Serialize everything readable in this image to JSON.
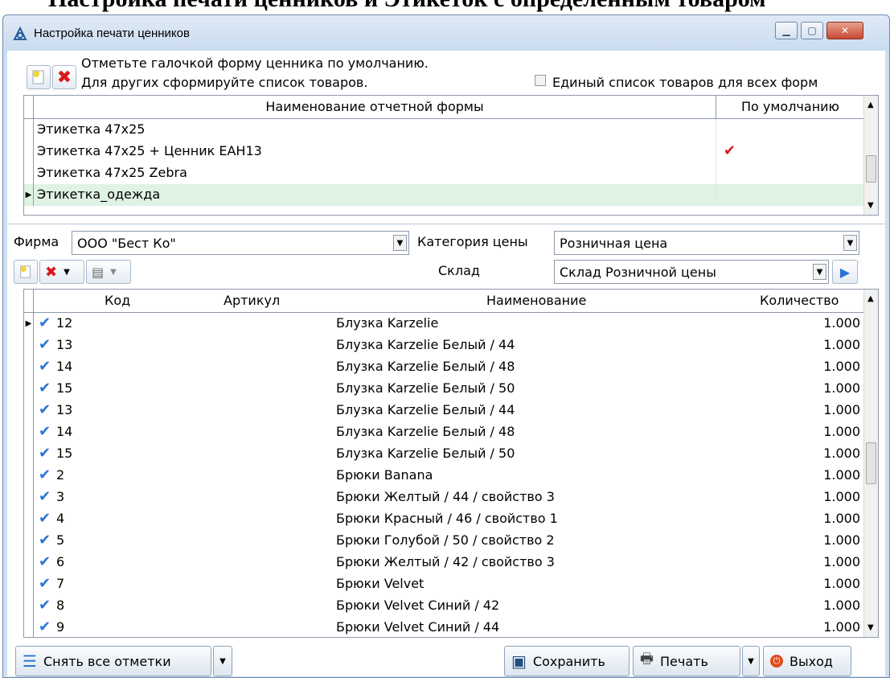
{
  "document_heading": "Настройка печати ценников и Этикеток с определенным товаром",
  "window": {
    "title": "Настройка печати ценников",
    "controls": [
      "minimize-icon",
      "maximize-icon",
      "close-icon"
    ]
  },
  "top": {
    "hint_line1": "Отметьте галочкой форму ценника по умолчанию.",
    "hint_line2": "Для других сформируйте список товаров.",
    "single_list_label": "Единый список товаров для всех форм",
    "single_list_checked": false
  },
  "forms_grid": {
    "columns": [
      "Наименование отчетной формы",
      "По умолчанию"
    ],
    "rows": [
      {
        "name": "Этикетка 47x25",
        "default": false,
        "selected": false
      },
      {
        "name": "Этикетка 47x25 + Ценник ЕАН13",
        "default": true,
        "selected": false
      },
      {
        "name": "Этикетка 47x25 Zebra",
        "default": false,
        "selected": false
      },
      {
        "name": "Этикетка_одежда",
        "default": false,
        "selected": true
      }
    ]
  },
  "filters": {
    "firm_label": "Фирма",
    "firm_value": "ООО \"Бест Ко\"",
    "price_category_label": "Категория цены",
    "price_category_value": "Розничная цена",
    "warehouse_label": "Склад",
    "warehouse_value": "Склад Розничной цены"
  },
  "items_grid": {
    "columns": [
      "Код",
      "Артикул",
      "Наименование",
      "Количество"
    ],
    "rows": [
      {
        "code": "12",
        "article": "",
        "name": "Блузка Karzelie",
        "qty": "1.000",
        "current": true
      },
      {
        "code": "13",
        "article": "",
        "name": "Блузка Karzelie Белый / 44",
        "qty": "1.000"
      },
      {
        "code": "14",
        "article": "",
        "name": "Блузка Karzelie Белый / 48",
        "qty": "1.000"
      },
      {
        "code": "15",
        "article": "",
        "name": "Блузка Karzelie Белый / 50",
        "qty": "1.000"
      },
      {
        "code": "13",
        "article": "",
        "name": "Блузка Karzelie Белый / 44",
        "qty": "1.000"
      },
      {
        "code": "14",
        "article": "",
        "name": "Блузка Karzelie Белый / 48",
        "qty": "1.000"
      },
      {
        "code": "15",
        "article": "",
        "name": "Блузка Karzelie Белый / 50",
        "qty": "1.000"
      },
      {
        "code": "2",
        "article": "",
        "name": "Брюки Banana",
        "qty": "1.000"
      },
      {
        "code": "3",
        "article": "",
        "name": "Брюки Желтый / 44 / свойство 3",
        "qty": "1.000"
      },
      {
        "code": "4",
        "article": "",
        "name": "Брюки Красный / 46 / свойство 1",
        "qty": "1.000"
      },
      {
        "code": "5",
        "article": "",
        "name": "Брюки Голубой / 50 / свойство 2",
        "qty": "1.000"
      },
      {
        "code": "6",
        "article": "",
        "name": "Брюки Желтый / 42 / свойство 3",
        "qty": "1.000"
      },
      {
        "code": "7",
        "article": "",
        "name": "Брюки Velvet",
        "qty": "1.000"
      },
      {
        "code": "8",
        "article": "",
        "name": "Брюки Velvet Синий / 42",
        "qty": "1.000"
      },
      {
        "code": "9",
        "article": "",
        "name": "Брюки Velvet Синий / 44",
        "qty": "1.000"
      }
    ]
  },
  "bottom": {
    "clear_marks": "Снять все отметки",
    "save": "Сохранить",
    "print": "Печать",
    "exit": "Выход"
  },
  "colors": {
    "selected_row": "#dff3e4",
    "check_red": "#d9191b",
    "check_blue": "#2b74d6"
  }
}
